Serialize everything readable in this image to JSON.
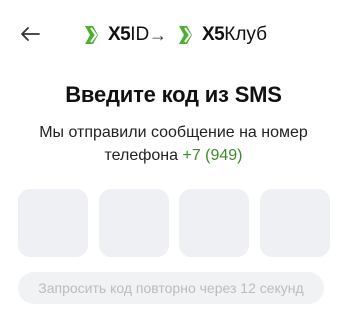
{
  "header": {
    "back_icon": "arrow-left-icon",
    "brand_left": {
      "strong": "X5",
      "light": "ID"
    },
    "separator": "→",
    "brand_right": {
      "strong": "X5",
      "light": "Клуб"
    }
  },
  "main": {
    "title": "Введите код из SMS",
    "subtitle_line1": "Мы отправили сообщение на номер",
    "subtitle_line2_prefix": "телефона ",
    "phone": "+7 (949)"
  },
  "code_inputs": [
    "",
    "",
    "",
    ""
  ],
  "resend_button": {
    "label": "Запросить код повторно через 12 секунд"
  },
  "colors": {
    "brand_green": "#4caf2e",
    "phone_green": "#3d8b2a",
    "box_bg": "#eff0f3",
    "disabled_text": "#b9bcc2"
  }
}
